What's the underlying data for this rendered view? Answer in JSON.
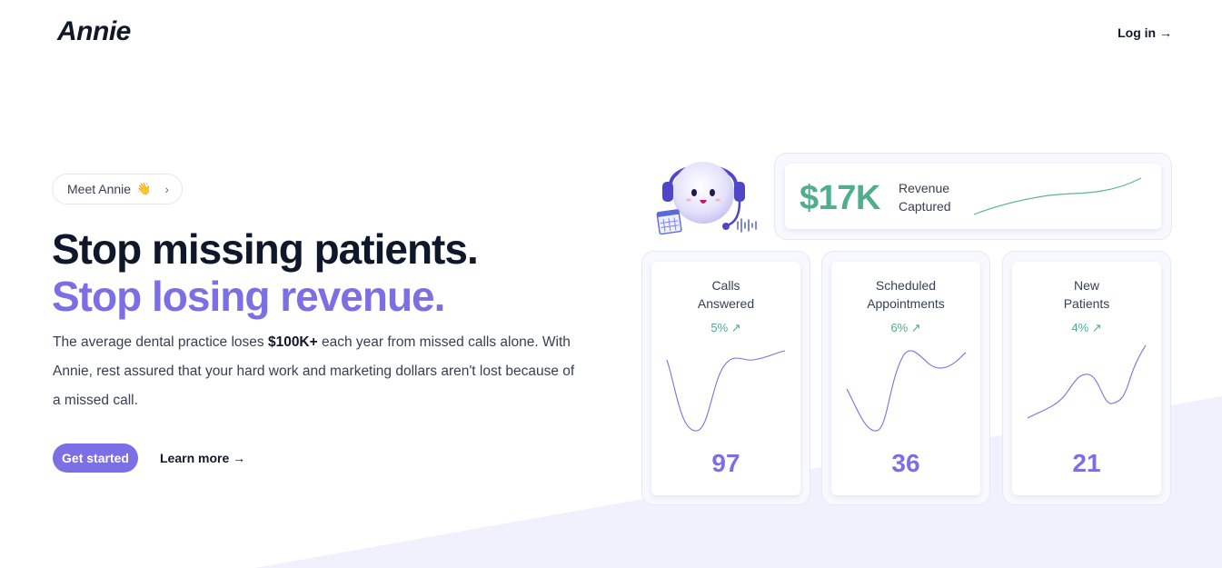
{
  "header": {
    "logo": "Annie",
    "login_label": "Log in →"
  },
  "hero": {
    "pill_label": "Meet Annie",
    "pill_emoji": "👋",
    "pill_icon": "chevron-right-icon",
    "headline_line1": "Stop missing patients.",
    "headline_line2": "Stop losing revenue.",
    "desc_before": "The average dental practice loses ",
    "desc_bold": "$100K+",
    "desc_after": " each year from missed calls alone. With Annie, rest assured that your hard work and marketing dollars aren't lost because of a missed call.",
    "primary_button": "Get started",
    "secondary_link": "Learn more →"
  },
  "revenue_card": {
    "amount": "$17K",
    "label": "Revenue Captured"
  },
  "stat_cards": [
    {
      "title": "Calls\nAnswered",
      "delta": "5% ↗",
      "value": "97"
    },
    {
      "title": "Scheduled\nAppointments",
      "delta": "6% ↗",
      "value": "36"
    },
    {
      "title": "New\nPatients",
      "delta": "4% ↗",
      "value": "21"
    }
  ],
  "colors": {
    "accent": "#7c6fe6",
    "positive": "#4fae8e",
    "text_dark": "#0f172a"
  },
  "icons": [
    "mascot-robot-icon",
    "calendar-icon",
    "sound-wave-icon",
    "chevron-right-icon",
    "arrow-up-right-icon"
  ]
}
